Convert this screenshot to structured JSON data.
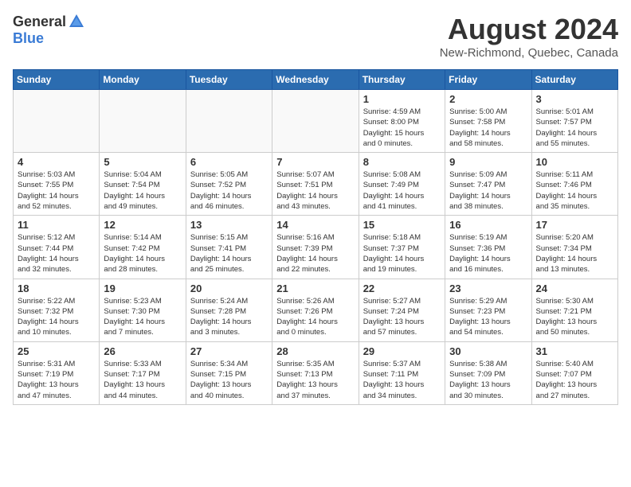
{
  "logo": {
    "general": "General",
    "blue": "Blue"
  },
  "title": {
    "month_year": "August 2024",
    "location": "New-Richmond, Quebec, Canada"
  },
  "header_days": [
    "Sunday",
    "Monday",
    "Tuesday",
    "Wednesday",
    "Thursday",
    "Friday",
    "Saturday"
  ],
  "weeks": [
    [
      {
        "day": "",
        "info": ""
      },
      {
        "day": "",
        "info": ""
      },
      {
        "day": "",
        "info": ""
      },
      {
        "day": "",
        "info": ""
      },
      {
        "day": "1",
        "info": "Sunrise: 4:59 AM\nSunset: 8:00 PM\nDaylight: 15 hours\nand 0 minutes."
      },
      {
        "day": "2",
        "info": "Sunrise: 5:00 AM\nSunset: 7:58 PM\nDaylight: 14 hours\nand 58 minutes."
      },
      {
        "day": "3",
        "info": "Sunrise: 5:01 AM\nSunset: 7:57 PM\nDaylight: 14 hours\nand 55 minutes."
      }
    ],
    [
      {
        "day": "4",
        "info": "Sunrise: 5:03 AM\nSunset: 7:55 PM\nDaylight: 14 hours\nand 52 minutes."
      },
      {
        "day": "5",
        "info": "Sunrise: 5:04 AM\nSunset: 7:54 PM\nDaylight: 14 hours\nand 49 minutes."
      },
      {
        "day": "6",
        "info": "Sunrise: 5:05 AM\nSunset: 7:52 PM\nDaylight: 14 hours\nand 46 minutes."
      },
      {
        "day": "7",
        "info": "Sunrise: 5:07 AM\nSunset: 7:51 PM\nDaylight: 14 hours\nand 43 minutes."
      },
      {
        "day": "8",
        "info": "Sunrise: 5:08 AM\nSunset: 7:49 PM\nDaylight: 14 hours\nand 41 minutes."
      },
      {
        "day": "9",
        "info": "Sunrise: 5:09 AM\nSunset: 7:47 PM\nDaylight: 14 hours\nand 38 minutes."
      },
      {
        "day": "10",
        "info": "Sunrise: 5:11 AM\nSunset: 7:46 PM\nDaylight: 14 hours\nand 35 minutes."
      }
    ],
    [
      {
        "day": "11",
        "info": "Sunrise: 5:12 AM\nSunset: 7:44 PM\nDaylight: 14 hours\nand 32 minutes."
      },
      {
        "day": "12",
        "info": "Sunrise: 5:14 AM\nSunset: 7:42 PM\nDaylight: 14 hours\nand 28 minutes."
      },
      {
        "day": "13",
        "info": "Sunrise: 5:15 AM\nSunset: 7:41 PM\nDaylight: 14 hours\nand 25 minutes."
      },
      {
        "day": "14",
        "info": "Sunrise: 5:16 AM\nSunset: 7:39 PM\nDaylight: 14 hours\nand 22 minutes."
      },
      {
        "day": "15",
        "info": "Sunrise: 5:18 AM\nSunset: 7:37 PM\nDaylight: 14 hours\nand 19 minutes."
      },
      {
        "day": "16",
        "info": "Sunrise: 5:19 AM\nSunset: 7:36 PM\nDaylight: 14 hours\nand 16 minutes."
      },
      {
        "day": "17",
        "info": "Sunrise: 5:20 AM\nSunset: 7:34 PM\nDaylight: 14 hours\nand 13 minutes."
      }
    ],
    [
      {
        "day": "18",
        "info": "Sunrise: 5:22 AM\nSunset: 7:32 PM\nDaylight: 14 hours\nand 10 minutes."
      },
      {
        "day": "19",
        "info": "Sunrise: 5:23 AM\nSunset: 7:30 PM\nDaylight: 14 hours\nand 7 minutes."
      },
      {
        "day": "20",
        "info": "Sunrise: 5:24 AM\nSunset: 7:28 PM\nDaylight: 14 hours\nand 3 minutes."
      },
      {
        "day": "21",
        "info": "Sunrise: 5:26 AM\nSunset: 7:26 PM\nDaylight: 14 hours\nand 0 minutes."
      },
      {
        "day": "22",
        "info": "Sunrise: 5:27 AM\nSunset: 7:24 PM\nDaylight: 13 hours\nand 57 minutes."
      },
      {
        "day": "23",
        "info": "Sunrise: 5:29 AM\nSunset: 7:23 PM\nDaylight: 13 hours\nand 54 minutes."
      },
      {
        "day": "24",
        "info": "Sunrise: 5:30 AM\nSunset: 7:21 PM\nDaylight: 13 hours\nand 50 minutes."
      }
    ],
    [
      {
        "day": "25",
        "info": "Sunrise: 5:31 AM\nSunset: 7:19 PM\nDaylight: 13 hours\nand 47 minutes."
      },
      {
        "day": "26",
        "info": "Sunrise: 5:33 AM\nSunset: 7:17 PM\nDaylight: 13 hours\nand 44 minutes."
      },
      {
        "day": "27",
        "info": "Sunrise: 5:34 AM\nSunset: 7:15 PM\nDaylight: 13 hours\nand 40 minutes."
      },
      {
        "day": "28",
        "info": "Sunrise: 5:35 AM\nSunset: 7:13 PM\nDaylight: 13 hours\nand 37 minutes."
      },
      {
        "day": "29",
        "info": "Sunrise: 5:37 AM\nSunset: 7:11 PM\nDaylight: 13 hours\nand 34 minutes."
      },
      {
        "day": "30",
        "info": "Sunrise: 5:38 AM\nSunset: 7:09 PM\nDaylight: 13 hours\nand 30 minutes."
      },
      {
        "day": "31",
        "info": "Sunrise: 5:40 AM\nSunset: 7:07 PM\nDaylight: 13 hours\nand 27 minutes."
      }
    ]
  ]
}
